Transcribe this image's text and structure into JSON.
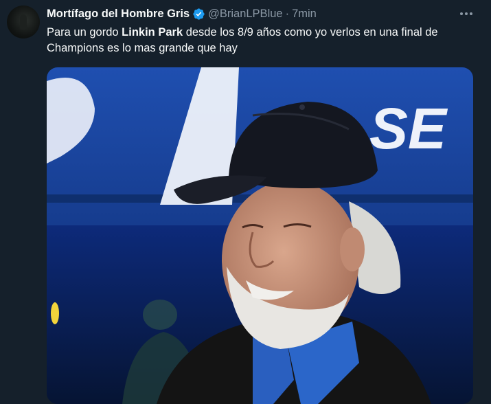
{
  "author": {
    "display_name": "Mortífago del Hombre Gris",
    "handle": "@BrianLPBlue",
    "separator": "·",
    "time": "7min",
    "verified_color": "#1d9bf0"
  },
  "tweet": {
    "text_before": "Para un gordo ",
    "text_bold": "Linkin Park",
    "text_after": " desde los 8/9 años como yo verlos en una final de Champions es lo mas grande que hay"
  },
  "media": {
    "background_letters": "SE",
    "icon": "photo"
  },
  "colors": {
    "background": "#15202b",
    "text": "#f7f9f9",
    "muted": "#8b98a5"
  }
}
